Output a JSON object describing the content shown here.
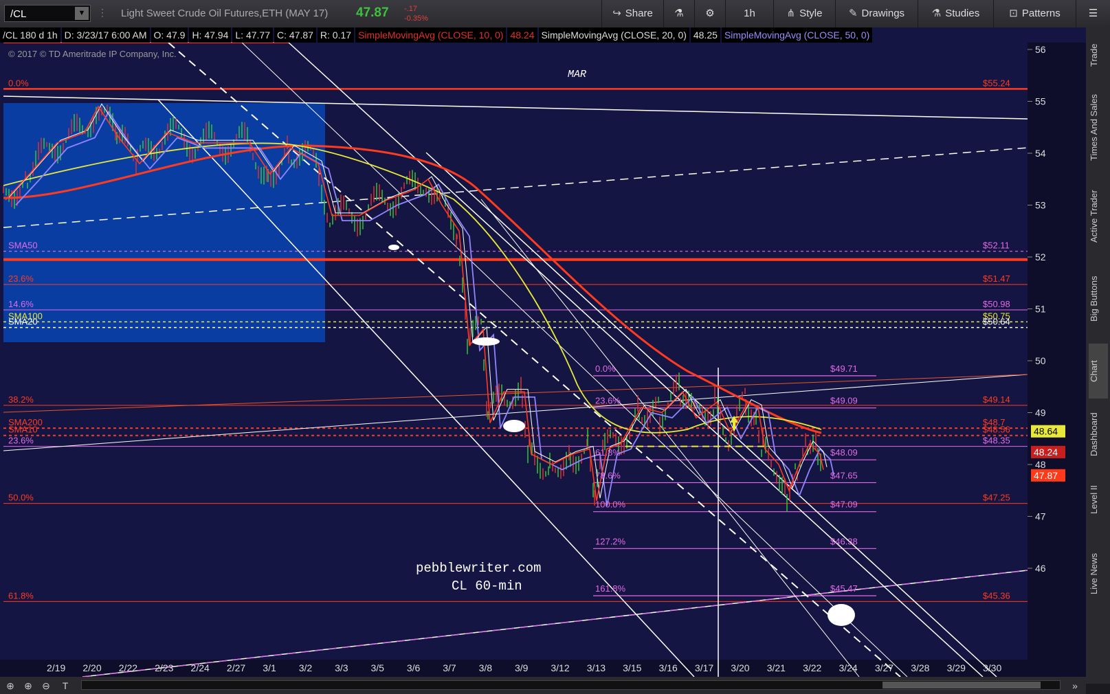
{
  "topbar": {
    "symbol": "/CL",
    "description": "Light Sweet Crude Oil Futures,ETH (MAY 17)",
    "last": "47.87",
    "change": "-.17",
    "change_pct": "-0.35%",
    "share": "Share",
    "timeframe": "1h",
    "style": "Style",
    "drawings": "Drawings",
    "studies": "Studies",
    "patterns": "Patterns"
  },
  "infobar": {
    "title": "/CL 180 d 1h",
    "date": "D: 3/23/17 6:00 AM",
    "open": "O: 47.9",
    "high": "H: 47.94",
    "low": "L: 47.77",
    "close": "C: 47.87",
    "range": "R: 0.17",
    "sma10": "SimpleMovingAvg (CLOSE, 10, 0)",
    "sma10_val": "48.24",
    "sma20": "SimpleMovingAvg (CLOSE, 20, 0)",
    "sma20_val": "48.25",
    "sma50": "SimpleMovingAvg (CLOSE, 50, 0)"
  },
  "chart": {
    "copyright": "© 2017 © TD Ameritrade IP Company, Inc.",
    "month_label": "MAR",
    "watermark_line1": "pebblewriter.com",
    "watermark_line2": "CL 60-min",
    "price_ticks": [
      "56",
      "55",
      "54",
      "53",
      "52",
      "51",
      "50",
      "49",
      "48",
      "47",
      "46"
    ],
    "date_ticks": [
      "2/19",
      "2/20",
      "2/22",
      "2/23",
      "2/24",
      "2/27",
      "3/1",
      "3/2",
      "3/3",
      "3/5",
      "3/6",
      "3/7",
      "3/8",
      "3/9",
      "3/12",
      "3/13",
      "3/15",
      "3/16",
      "3/17",
      "3/20",
      "3/21",
      "3/22",
      "3/24",
      "3/27",
      "3/28",
      "3/29",
      "3/30"
    ],
    "left_labels": [
      "0.0%",
      "SMA50",
      "23.6%",
      "14.6%",
      "SMA100",
      "SMA20",
      "38.2%",
      "SMA200",
      "SMA10",
      "23.6%",
      "50.0%",
      "61.8%"
    ],
    "right_labels": [
      "$55.24",
      "$52.11",
      "$51.47",
      "$50.98",
      "$50.75",
      "$50.64",
      "$49.14",
      "$48.7",
      "$48.56",
      "$48.35",
      "$47.25",
      "$45.36"
    ],
    "fib_pct": [
      "0.0%",
      "23.6%",
      "61.8%",
      "78.6%",
      "100.0%",
      "127.2%",
      "161.8%"
    ],
    "fib_vals": [
      "$49.71",
      "$49.09",
      "$48.09",
      "$47.65",
      "$47.09",
      "$46.38",
      "$45.47"
    ],
    "price_flags": [
      "48.64",
      "48.24",
      "47.87"
    ],
    "colors": {
      "bg": "#141542",
      "red": "#ff3b1f",
      "yellow": "#e8e83a",
      "purple": "#8f86ff",
      "magenta": "#e46ae8",
      "white": "#ffffff",
      "blue_rect": "#0a3fa8"
    }
  },
  "sidebar": [
    "Trade",
    "Times And Sales",
    "Active Trader",
    "Big Buttons",
    "Chart",
    "Dashboard",
    "Level II",
    "Live News"
  ],
  "icons": {
    "share": "share-icon",
    "flask": "flask-icon",
    "gear": "gear-icon",
    "style": "style-icon",
    "pencil": "pencil-icon",
    "studies": "studies-icon",
    "patterns": "patterns-icon",
    "menu": "menu-icon"
  }
}
